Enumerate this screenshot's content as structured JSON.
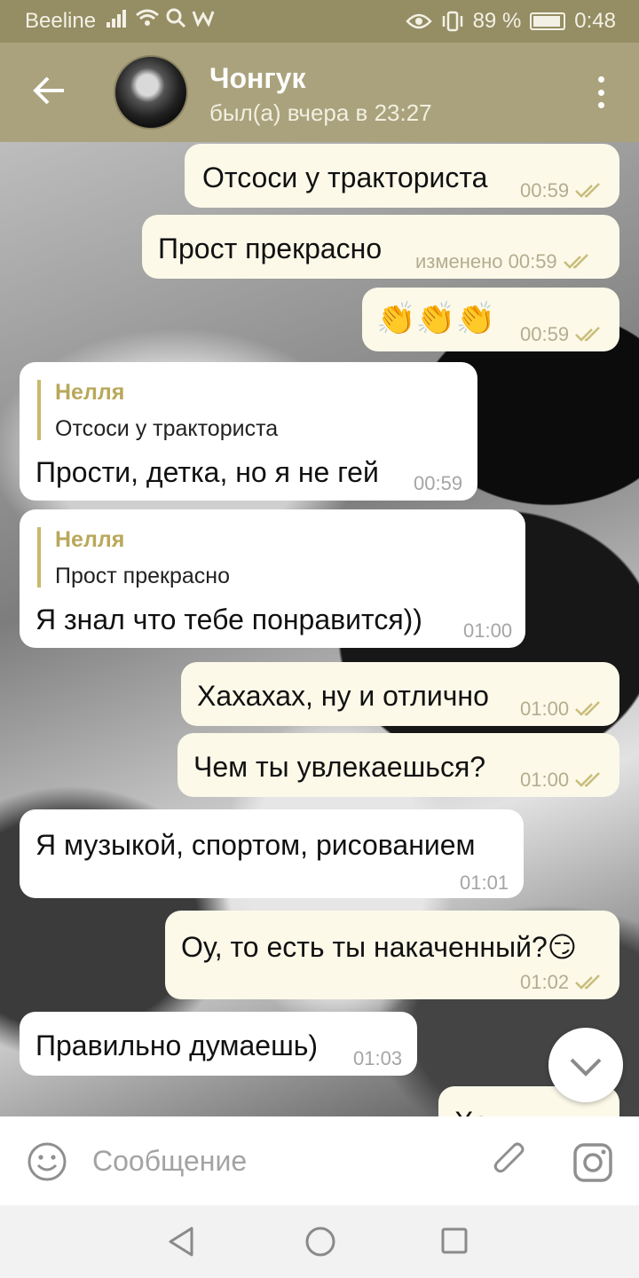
{
  "status_bar": {
    "carrier": "Beeline",
    "battery_percent": "89 %",
    "time": "0:48",
    "icons": [
      "signal-icon",
      "wifi-icon",
      "search-icon",
      "w-icon",
      "eye-icon",
      "vibrate-icon",
      "battery-icon"
    ]
  },
  "header": {
    "name": "Чонгук",
    "status": "был(а) вчера в 23:27",
    "icons": [
      "back-arrow-icon",
      "avatar",
      "more-vert-icon"
    ]
  },
  "colors": {
    "status_bar": "#958d63",
    "header": "#aaa27c",
    "outgoing_bubble": "#fcf9e9",
    "incoming_bubble": "#ffffff",
    "reply_accent": "#b9a85a",
    "read_checks": "#c9bd7a"
  },
  "messages": [
    {
      "direction": "out",
      "text": "Отсоси у тракториста",
      "time": "00:59",
      "read": true
    },
    {
      "direction": "out",
      "text": "Прост прекрасно",
      "time": "изменено 00:59",
      "read": true
    },
    {
      "direction": "out",
      "text": "👏👏👏",
      "time": "00:59",
      "read": true
    },
    {
      "direction": "in",
      "reply_author": "Нелля",
      "reply_text": "Отсоси у тракториста",
      "text": "Прости, детка, но я не гей",
      "time": "00:59"
    },
    {
      "direction": "in",
      "reply_author": "Нелля",
      "reply_text": "Прост прекрасно",
      "text": "Я знал что тебе понравится))",
      "time": "01:00"
    },
    {
      "direction": "out",
      "text": "Хахахах, ну и отлично",
      "time": "01:00",
      "read": true
    },
    {
      "direction": "out",
      "text": "Чем ты увлекаешься?",
      "time": "01:00",
      "read": true
    },
    {
      "direction": "in",
      "text": "Я музыкой, спортом, рисованием",
      "time": "01:01"
    },
    {
      "direction": "out",
      "text": "Оу, то есть ты накаченный?😏",
      "time": "01:02",
      "read": true
    },
    {
      "direction": "in",
      "text": "Правильно думаешь)",
      "time": "01:03"
    },
    {
      "direction": "out",
      "text": "Хах",
      "partial": true
    }
  ],
  "input": {
    "placeholder": "Сообщение",
    "icons": [
      "emoji-icon",
      "attach-icon",
      "camera-icon"
    ]
  },
  "scroll_button_icon": "chevron-down-icon",
  "nav_bar": {
    "icons": [
      "nav-back-icon",
      "nav-home-icon",
      "nav-recent-icon"
    ]
  }
}
